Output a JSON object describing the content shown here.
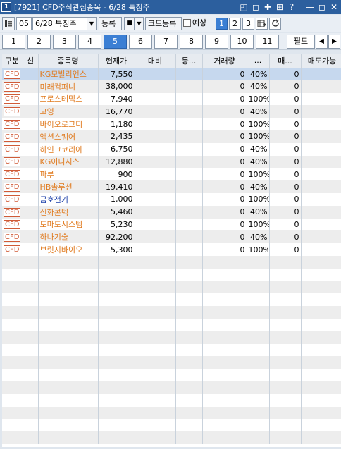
{
  "window": {
    "icon_label": "1",
    "title": "[7921] CFD주식관심종목 - 6/28 특징주",
    "controls": [
      "◰",
      "◻",
      "✚",
      "⊞",
      "?",
      "—",
      "◻",
      "✕"
    ]
  },
  "toolbar": {
    "group_no": "05",
    "group_name": "6/28 특징주",
    "register_label": "등록",
    "square_label": "■",
    "code_register_label": "코드등록",
    "forecast_label": "예상",
    "view_buttons": [
      "1",
      "2",
      "3"
    ],
    "active_view": "1"
  },
  "pages": {
    "items": [
      "1",
      "2",
      "3",
      "4",
      "5",
      "6",
      "7",
      "8",
      "9",
      "10",
      "11"
    ],
    "active": "5",
    "field_label": "필드"
  },
  "table": {
    "columns": [
      "구분",
      "신",
      "종목명",
      "현재가",
      "대비",
      "등...",
      "거래량",
      "...",
      "매...",
      "매도가능"
    ],
    "rows": [
      {
        "type": "CFD",
        "name": "KG모빌리언스",
        "price": "7,550",
        "volume": "0",
        "pct": "40%",
        "sell": "0",
        "color": "orange"
      },
      {
        "type": "CFD",
        "name": "미래컴퍼니",
        "price": "38,000",
        "volume": "0",
        "pct": "40%",
        "sell": "0",
        "color": "orange"
      },
      {
        "type": "CFD",
        "name": "프로스테믹스",
        "price": "7,940",
        "volume": "0",
        "pct": "100%",
        "sell": "0",
        "color": "orange"
      },
      {
        "type": "CFD",
        "name": "고영",
        "price": "16,770",
        "volume": "0",
        "pct": "40%",
        "sell": "0",
        "color": "orange"
      },
      {
        "type": "CFD",
        "name": "바이오로그디",
        "price": "1,180",
        "volume": "0",
        "pct": "100%",
        "sell": "0",
        "color": "orange"
      },
      {
        "type": "CFD",
        "name": "액션스퀘어",
        "price": "2,435",
        "volume": "0",
        "pct": "100%",
        "sell": "0",
        "color": "orange"
      },
      {
        "type": "CFD",
        "name": "하인크코리아",
        "price": "6,750",
        "volume": "0",
        "pct": "40%",
        "sell": "0",
        "color": "orange"
      },
      {
        "type": "CFD",
        "name": "KG이니시스",
        "price": "12,880",
        "volume": "0",
        "pct": "40%",
        "sell": "0",
        "color": "orange"
      },
      {
        "type": "CFD",
        "name": "파루",
        "price": "900",
        "volume": "0",
        "pct": "100%",
        "sell": "0",
        "color": "orange"
      },
      {
        "type": "CFD",
        "name": "HB솔루션",
        "price": "19,410",
        "volume": "0",
        "pct": "40%",
        "sell": "0",
        "color": "orange"
      },
      {
        "type": "CFD",
        "name": "금호전기",
        "price": "1,000",
        "volume": "0",
        "pct": "100%",
        "sell": "0",
        "color": "blue"
      },
      {
        "type": "CFD",
        "name": "신화콘텍",
        "price": "5,460",
        "volume": "0",
        "pct": "40%",
        "sell": "0",
        "color": "orange"
      },
      {
        "type": "CFD",
        "name": "토마토시스템",
        "price": "5,230",
        "volume": "0",
        "pct": "100%",
        "sell": "0",
        "color": "orange"
      },
      {
        "type": "CFD",
        "name": "하나기술",
        "price": "92,200",
        "volume": "0",
        "pct": "40%",
        "sell": "0",
        "color": "orange"
      },
      {
        "type": "CFD",
        "name": "브릿지바이오",
        "price": "5,300",
        "volume": "0",
        "pct": "100%",
        "sell": "0",
        "color": "orange"
      }
    ],
    "empty_rows": 15
  }
}
